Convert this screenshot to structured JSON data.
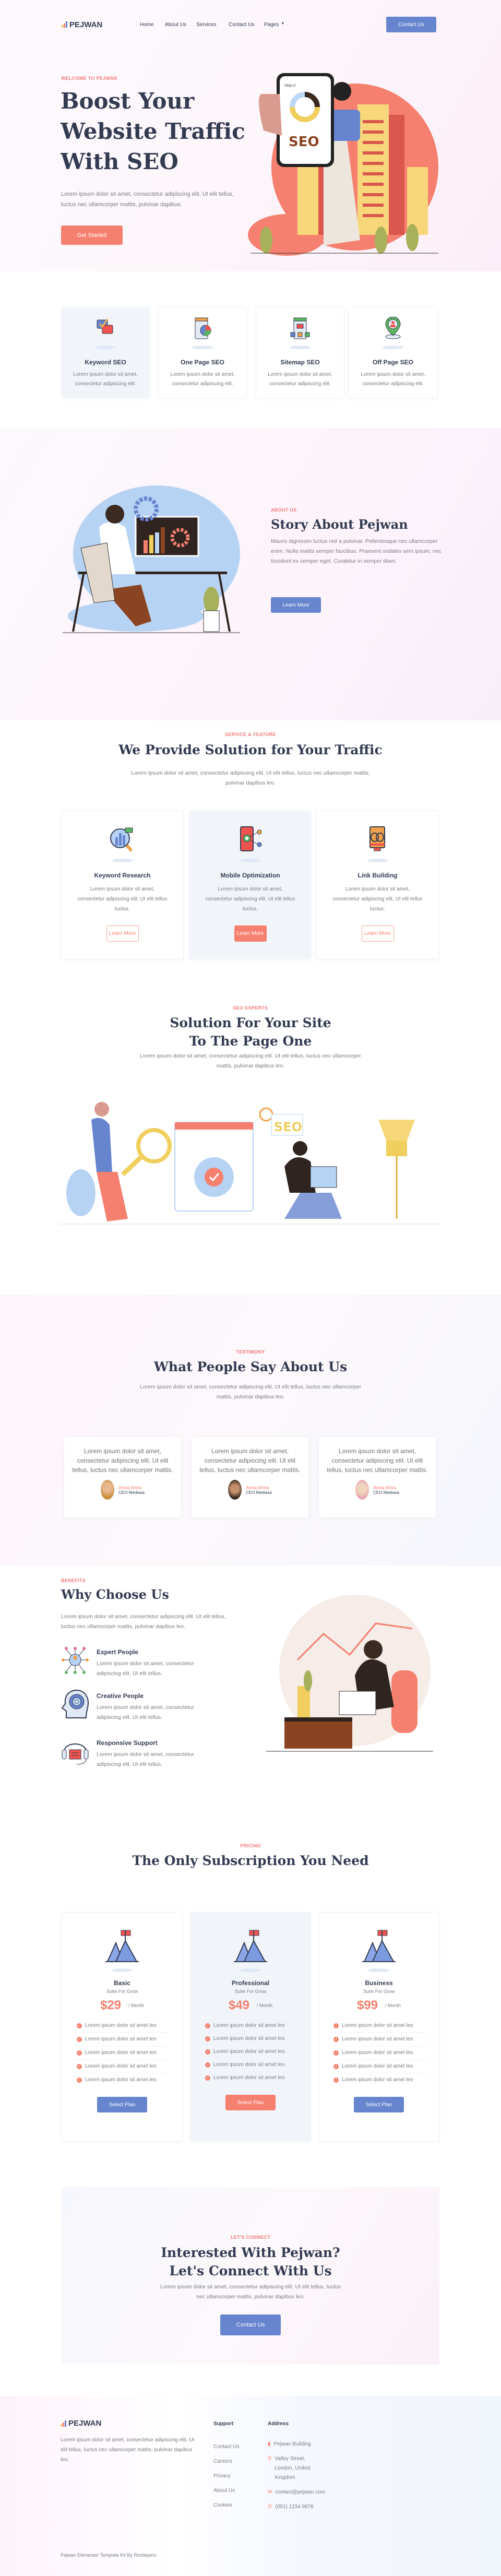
{
  "nav": {
    "brand": "PEJWAN",
    "links": [
      "Home",
      "About Us",
      "Services",
      "Contact Us",
      "Pages"
    ],
    "cta": "Contact Us"
  },
  "hero": {
    "eyebrow": "WELCOME TO PEJWAN",
    "title_lines": [
      "Boost Your",
      "Website Traffic",
      "With SEO"
    ],
    "text": "Lorem ipsum dolor sit amet, consectetur adipiscing elit. Ut elit tellus, luctus nec ullamcorper mattis, pulvinar dapibus.",
    "cta": "Get Started",
    "phone_url": "http://",
    "phone_label": "SEO"
  },
  "features": [
    {
      "title": "Keyword SEO",
      "text": "Lorem ipsum dolor sit amet, consectetur adipiscing elit.",
      "icon": "chat-check-icon"
    },
    {
      "title": "One Page SEO",
      "text": "Lorem ipsum dolor sit amet, consectetur adipiscing elit.",
      "icon": "pie-chart-page-icon"
    },
    {
      "title": "Sitemap SEO",
      "text": "Lorem ipsum dolor sit amet, consectetur adipiscing elit.",
      "icon": "sitemap-icon"
    },
    {
      "title": "Off Page SEO",
      "text": "Lorem ipsum dolor sit amet, consectetur adipiscing elit.",
      "icon": "location-pin-user-icon"
    }
  ],
  "about": {
    "eyebrow": "ABOUT US",
    "title": "Story About Pejwan",
    "text": "Mauris dignissim luctus nisl a pulvinar. Pellentesque nec ullamcorper enim. Nulla mattis semper faucibus. Praesent sodales sem ipsum, nec tincidunt ex semper eget. Curabitur in semper diam.",
    "cta": "Learn More"
  },
  "services": {
    "eyebrow": "SERVICE & FEATURE",
    "title": "We Provide Solution for Your Traffic",
    "text": "Lorem ipsum dolor sit amet, consectetur adipiscing elit. Ut elit tellus, luctus nec ullamcorper mattis, pulvinar dapibus leo.",
    "items": [
      {
        "title": "Keyword Research",
        "text": "Lorem ipsum dolor sit amet, consectetur adipiscing elit. Ut elit tellus luctus.",
        "cta": "Learn More"
      },
      {
        "title": "Mobile Optimization",
        "text": "Lorem ipsum dolor sit amet, consectetur adipiscing elit. Ut elit tellus luctus.",
        "cta": "Learn More"
      },
      {
        "title": "Link Building",
        "text": "Lorem ipsum dolor sit amet, consectetur adipiscing elit. Ut elit tellus luctus.",
        "cta": "Learn More"
      }
    ]
  },
  "experts": {
    "eyebrow": "SEO EXPERTS",
    "title_lines": [
      "Solution For Your Site",
      "To The Page One"
    ],
    "text": "Lorem ipsum dolor sit amet, consectetur adipiscing elit. Ut elit tellus, luctus nec ullamcorper mattis, pulvinar dapibus leo.",
    "badge": "SEO"
  },
  "testimony": {
    "eyebrow": "TESTIMONY",
    "title": "What People Say About Us",
    "text": "Lorem ipsum dolor sit amet, consectetur adipiscing elit. Ut elit tellus, luctus nec ullamcorper mattis, pulvinar dapibus leo.",
    "items": [
      {
        "quote": "Lorem ipsum dolor sit amet, consectetur adipiscing elit. Ut elit tellus, luctus nec ullamcorper mattis.",
        "name": "Anna Ahira",
        "role": "CEO Mediasa"
      },
      {
        "quote": "Lorem ipsum dolor sit amet, consectetur adipiscing elit. Ut elit tellus, luctus nec ullamcorper mattis.",
        "name": "Anna Ahira",
        "role": "CEO Mediasa"
      },
      {
        "quote": "Lorem ipsum dolor sit amet, consectetur adipiscing elit. Ut elit tellus, luctus nec ullamcorper mattis.",
        "name": "Anna Ahira",
        "role": "CEO Mediasa"
      }
    ]
  },
  "benefits": {
    "eyebrow": "BENEFITS",
    "title": "Why Choose Us",
    "text": "Lorem ipsum dolor sit amet, consectetur adipiscing elit. Ut elit tellus, luctus nec ullamcorper mattis, pulvinar dapibus leo.",
    "items": [
      {
        "title": "Expert People",
        "text": "Lorem ipsum dolor sit amet, consectetur adipiscing elit. Ut elit tellus."
      },
      {
        "title": "Creative People",
        "text": "Lorem ipsum dolor sit amet, consectetur adipiscing elit. Ut elit tellus."
      },
      {
        "title": "Responsive Support",
        "text": "Lorem ipsum dolor sit amet, consectetur adipiscing elit. Ut elit tellus."
      }
    ]
  },
  "pricing": {
    "eyebrow": "PRICING",
    "title": "The Only Subscription You Need",
    "plans": [
      {
        "name": "Basic",
        "sub": "Suite For Grow",
        "price": "$29",
        "period": "/ Month",
        "features": [
          "Lorem ipsum dolor sit amet leo",
          "Lorem ipsum dolor sit amet leo",
          "Lorem ipsum dolor sit amet leo",
          "Lorem ipsum dolor sit amet leo",
          "Lorem ipsum dolor sit amet leo"
        ],
        "cta": "Select Plan"
      },
      {
        "name": "Professional",
        "sub": "Suite For Grow",
        "price": "$49",
        "period": "/ Month",
        "features": [
          "Lorem ipsum dolor sit amet leo",
          "Lorem ipsum dolor sit amet leo",
          "Lorem ipsum dolor sit amet leo",
          "Lorem ipsum dolor sit amet leo",
          "Lorem ipsum dolor sit amet leo"
        ],
        "cta": "Select Plan"
      },
      {
        "name": "Business",
        "sub": "Suite For Grow",
        "price": "$99",
        "period": "/ Month",
        "features": [
          "Lorem ipsum dolor sit amet leo",
          "Lorem ipsum dolor sit amet leo",
          "Lorem ipsum dolor sit amet leo",
          "Lorem ipsum dolor sit amet leo",
          "Lorem ipsum dolor sit amet leo"
        ],
        "cta": "Select Plan"
      }
    ]
  },
  "connect": {
    "eyebrow": "LET'S CONNECT",
    "title_lines": [
      "Interested With Pejwan?",
      "Let's Connect With Us"
    ],
    "text": "Lorem ipsum dolor sit amet, consectetur adipiscing elit. Ut elit tellus, luctus nec ullamcorper mattis, pulvinar dapibus leo.",
    "cta": "Contact Us"
  },
  "footer": {
    "brand": "PEJWAN",
    "text": "Lorem ipsum dolor sit amet, consectetur adipiscing elit. Ut elit tellus, luctus nec ullamcorper mattis, pulvinar dapibus leo.",
    "support_title": "Support",
    "support_links": [
      "Contact Us",
      "Careers",
      "Privacy",
      "About Us",
      "Cookies"
    ],
    "address_title": "Address",
    "address": {
      "building": "Pejwan Building",
      "street": "Valley Street, London, United Kingdom",
      "email": "contact@pejwan.com",
      "phone": "(001) 1234 9876"
    },
    "copyright": "Pejwan Elementor Template Kit By Rootlayers"
  },
  "colors": {
    "accent_blue": "#6784cf",
    "accent_coral": "#f6806f",
    "heading": "#333b52"
  }
}
